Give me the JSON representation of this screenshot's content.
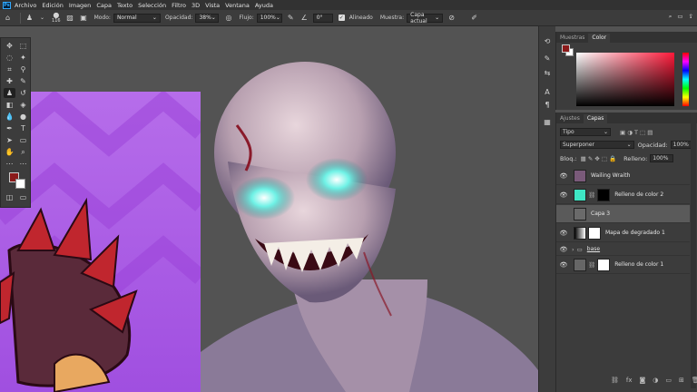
{
  "menu": {
    "logo": "Ps",
    "items": [
      "Archivo",
      "Edición",
      "Imagen",
      "Capa",
      "Texto",
      "Selección",
      "Filtro",
      "3D",
      "Vista",
      "Ventana",
      "Ayuda"
    ]
  },
  "options": {
    "brush_size": "116",
    "mode_label": "Modo:",
    "mode_value": "Normal",
    "opacity_label": "Opacidad:",
    "opacity_value": "38%",
    "flow_label": "Flujo:",
    "flow_value": "100%",
    "angle_value": "0°",
    "aligned_label": "Alineado",
    "sample_label": "Muestra:",
    "sample_value": "Capa actual"
  },
  "color_panel": {
    "tabs": [
      "Muestras",
      "Color"
    ],
    "active_tab": "Color",
    "foreground": "#8b1a1a",
    "background": "#ffffff"
  },
  "layers_panel": {
    "tabs": [
      "Ajustes",
      "Capas"
    ],
    "active_tab": "Capas",
    "filter_value": "Tipo",
    "blend_mode": "Superponer",
    "opacity_label": "Opacidad:",
    "opacity_value": "100%",
    "lock_label": "Bloq.:",
    "fill_label": "Relleno:",
    "fill_value": "100%",
    "layers": [
      {
        "name": "Wailing Wraith",
        "thumb": "#7a5a7a",
        "selected": false
      },
      {
        "name": "Relleno de color 2",
        "thumb": "#3ee6c4",
        "selected": false
      },
      {
        "name": "Capa 3",
        "thumb": "#6a6a6a",
        "selected": true
      },
      {
        "name": "Mapa de degradado 1",
        "thumb": "#ffffff",
        "selected": false
      },
      {
        "name": "base",
        "thumb": "#777777",
        "selected": false
      },
      {
        "name": "Relleno de color 1",
        "thumb": "#666666",
        "selected": false
      }
    ]
  },
  "colors": {
    "accent": "#31a8ff",
    "eye_glow": "#3ee6d4",
    "purple_art": "#a855e8"
  }
}
